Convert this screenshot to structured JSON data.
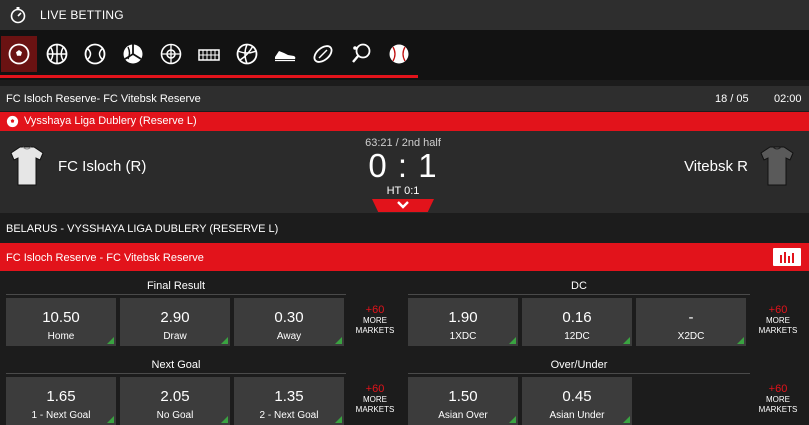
{
  "app": {
    "title": "LIVE BETTING"
  },
  "sports": [
    {
      "icon": "soccer-ball-icon",
      "active": true
    },
    {
      "icon": "basketball-icon",
      "active": false
    },
    {
      "icon": "tennis-ball-icon",
      "active": false
    },
    {
      "icon": "volleyball-icon",
      "active": false
    },
    {
      "icon": "handball-icon",
      "active": false
    },
    {
      "icon": "ice-hockey-icon",
      "active": false
    },
    {
      "icon": "volleyball-alt-icon",
      "active": false
    },
    {
      "icon": "sneaker-icon",
      "active": false
    },
    {
      "icon": "rugby-ball-icon",
      "active": false
    },
    {
      "icon": "table-tennis-icon",
      "active": false
    },
    {
      "icon": "baseball-icon",
      "active": false
    }
  ],
  "match": {
    "header_title": "FC Isloch Reserve- FC Vitebsk Reserve",
    "date": "18 / 05",
    "time": "02:00",
    "league": "Vysshaya Liga Dublery (Reserve L)",
    "clock": "63:21 / 2nd half",
    "score": "0 : 1",
    "halftime": "HT 0:1",
    "home": "FC Isloch (R)",
    "away": "Vitebsk R",
    "home_shirt_color": "#e6e6e6",
    "away_shirt_color": "#5a5a5a"
  },
  "league_title": "BELARUS - VYSSHAYA LIGA DUBLERY (RESERVE L)",
  "event_title": "FC Isloch Reserve  - FC Vitebsk Reserve",
  "markets": {
    "final_result": {
      "title": "Final Result",
      "odds": [
        {
          "value": "10.50",
          "label": "Home",
          "trend": true
        },
        {
          "value": "2.90",
          "label": "Draw",
          "trend": true
        },
        {
          "value": "0.30",
          "label": "Away",
          "trend": true
        }
      ],
      "more_plus": "+60",
      "more_label": "MORE MARKETS"
    },
    "dc": {
      "title": "DC",
      "odds": [
        {
          "value": "1.90",
          "label": "1XDC",
          "trend": true
        },
        {
          "value": "0.16",
          "label": "12DC",
          "trend": true
        },
        {
          "value": "-",
          "label": "X2DC",
          "trend": true
        }
      ],
      "more_plus": "+60",
      "more_label": "MORE MARKETS"
    },
    "next_goal": {
      "title": "Next Goal",
      "odds": [
        {
          "value": "1.65",
          "label": "1 - Next Goal",
          "trend": true
        },
        {
          "value": "2.05",
          "label": "No Goal",
          "trend": true
        },
        {
          "value": "1.35",
          "label": "2 - Next Goal",
          "trend": true
        }
      ],
      "more_plus": "+60",
      "more_label": "MORE MARKETS"
    },
    "over_under": {
      "title": "Over/Under",
      "odds": [
        {
          "value": "1.50",
          "label": "Asian Over",
          "trend": true
        },
        {
          "value": "0.45",
          "label": "Asian Under",
          "trend": true
        }
      ],
      "more_plus": "+60",
      "more_label": "MORE MARKETS"
    }
  },
  "colors": {
    "accent": "#e2131b",
    "trend_up": "#3aa341",
    "panel": "#2e2e2e"
  }
}
